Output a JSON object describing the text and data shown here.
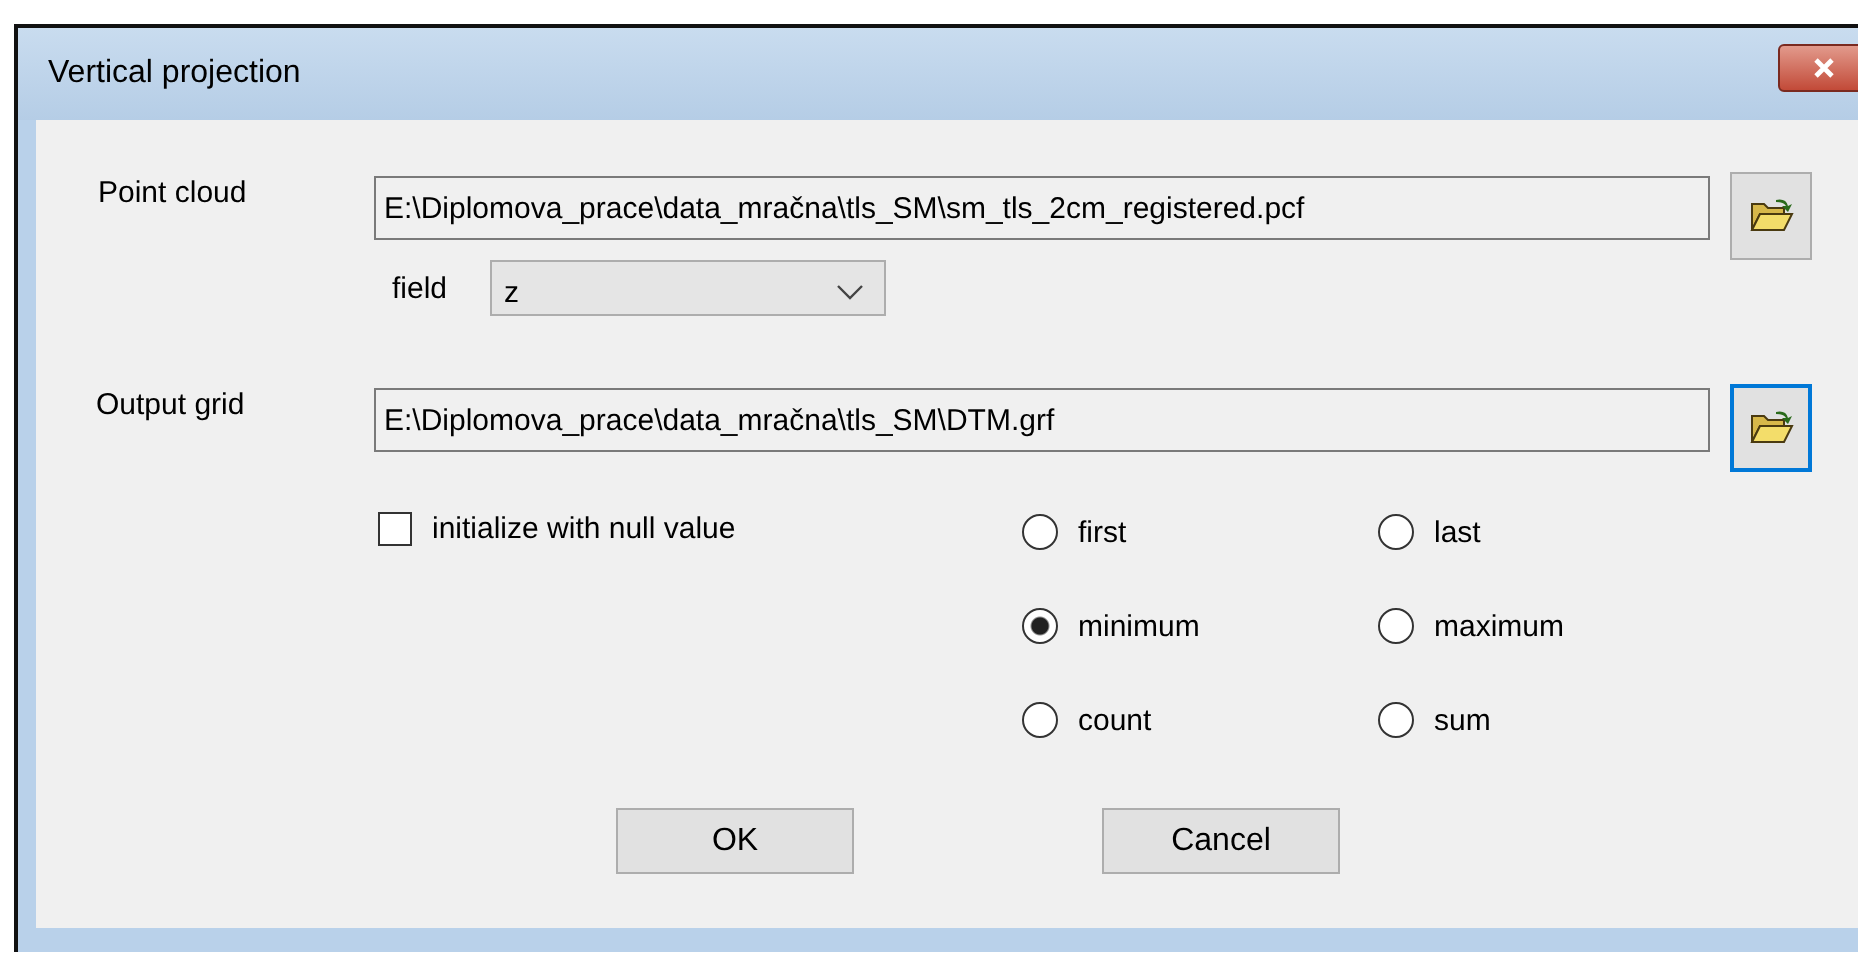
{
  "window": {
    "title": "Vertical projection"
  },
  "point_cloud": {
    "label": "Point cloud",
    "value": "E:\\Diplomova_prace\\data_mračna\\tls_SM\\sm_tls_2cm_registered.pcf",
    "browse_focused": false
  },
  "field": {
    "label": "field",
    "value": "z"
  },
  "output_grid": {
    "label": "Output grid",
    "value": "E:\\Diplomova_prace\\data_mračna\\tls_SM\\DTM.grf",
    "browse_focused": true
  },
  "initialize": {
    "label": "initialize with null value",
    "checked": false
  },
  "options": [
    {
      "label": "first",
      "selected": false
    },
    {
      "label": "last",
      "selected": false
    },
    {
      "label": "minimum",
      "selected": true
    },
    {
      "label": "maximum",
      "selected": false
    },
    {
      "label": "count",
      "selected": false
    },
    {
      "label": "sum",
      "selected": false
    }
  ],
  "buttons": [
    "OK",
    "Cancel"
  ]
}
